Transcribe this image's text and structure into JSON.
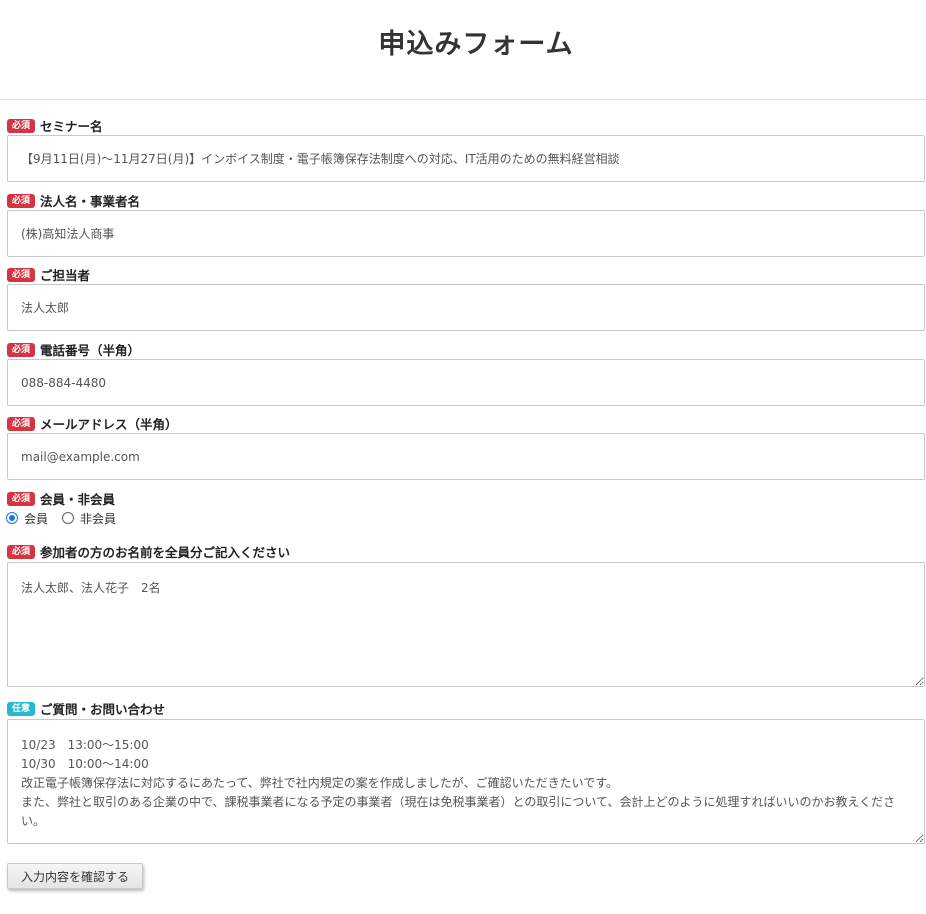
{
  "title": "申込みフォーム",
  "badges": {
    "required": "必須",
    "optional": "任意"
  },
  "fields": {
    "seminar": {
      "label": "セミナー名",
      "value": "【9月11日(月)～11月27日(月)】インボイス制度・電子帳簿保存法制度への対応、IT活用のための無料経営相談"
    },
    "company": {
      "label": "法人名・事業者名",
      "value": "(株)高知法人商事"
    },
    "contact": {
      "label": "ご担当者",
      "value": "法人太郎"
    },
    "phone": {
      "label": "電話番号（半角）",
      "value": "088-884-4480"
    },
    "email": {
      "label": "メールアドレス（半角）",
      "value": "mail@example.com"
    },
    "membership": {
      "label": "会員・非会員",
      "options": [
        "会員",
        "非会員"
      ],
      "selected": "会員"
    },
    "participants": {
      "label": "参加者の方のお名前を全員分ご記入ください",
      "value": "法人太郎、法人花子　2名"
    },
    "inquiry": {
      "label": "ご質問・お問い合わせ",
      "value": "10/23　13:00～15:00\n10/30　10:00～14:00\n改正電子帳簿保存法に対応するにあたって、弊社で社内規定の案を作成しましたが、ご確認いただきたいです。\nまた、弊社と取引のある企業の中で、課税事業者になる予定の事業者（現在は免税事業者）との取引について、会計上どのように処理すればいいのかお教えください。"
    }
  },
  "submit_label": "入力内容を確認する",
  "colors": {
    "required_badge": "#d43545",
    "optional_badge": "#26b7d3",
    "radio_accent": "#1a73e8"
  }
}
